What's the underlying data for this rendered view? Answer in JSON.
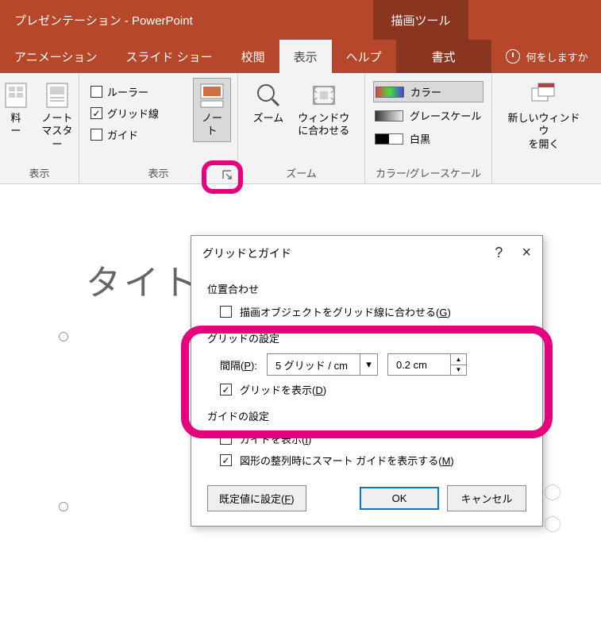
{
  "titlebar": {
    "title": "プレゼンテーション  -  PowerPoint",
    "context_tool": "描画ツール"
  },
  "tabs": {
    "animation": "アニメーション",
    "slideshow": "スライド ショー",
    "review": "校閲",
    "view": "表示",
    "help": "ヘルプ",
    "format": "書式",
    "tellme": "何をしますか"
  },
  "ribbon": {
    "masters": {
      "item1": "料\nー",
      "item2": "ノート\nマスター",
      "label": "表示"
    },
    "show": {
      "ruler": "ルーラー",
      "gridlines": "グリッド線",
      "guides": "ガイド",
      "notes": "ノー\nト",
      "label": "表示"
    },
    "zoom": {
      "zoom": "ズーム",
      "fit": "ウィンドウ\nに合わせる",
      "label": "ズーム"
    },
    "color": {
      "color": "カラー",
      "gray": "グレースケール",
      "bw": "白黒",
      "label": "カラー/グレースケール"
    },
    "window": {
      "new": "新しいウィンドウ\nを開く"
    }
  },
  "slide": {
    "title_placeholder": "タイト"
  },
  "dialog": {
    "title": "グリッドとガイド",
    "help": "?",
    "close": "×",
    "section_align": "位置合わせ",
    "snap_label_a": "描画オブジェクトをグリッド線に合わせる(",
    "snap_label_u": "G",
    "snap_label_b": ")",
    "section_grid": "グリッドの設定",
    "spacing_label_a": "間隔(",
    "spacing_label_u": "P",
    "spacing_label_b": "):",
    "spacing_combo": "5 グリッド / cm",
    "spacing_value": "0.2 cm",
    "show_grid_a": "グリッドを表示(",
    "show_grid_u": "D",
    "show_grid_b": ")",
    "section_guide": "ガイドの設定",
    "show_guide_a": "ガイドを表示(",
    "show_guide_u": "I",
    "show_guide_b": ")",
    "smart_guide_a": "図形の整列時にスマート ガイドを表示する(",
    "smart_guide_u": "M",
    "smart_guide_b": ")",
    "btn_default_a": "既定値に設定(",
    "btn_default_u": "F",
    "btn_default_b": ")",
    "btn_ok": "OK",
    "btn_cancel": "キャンセル"
  }
}
